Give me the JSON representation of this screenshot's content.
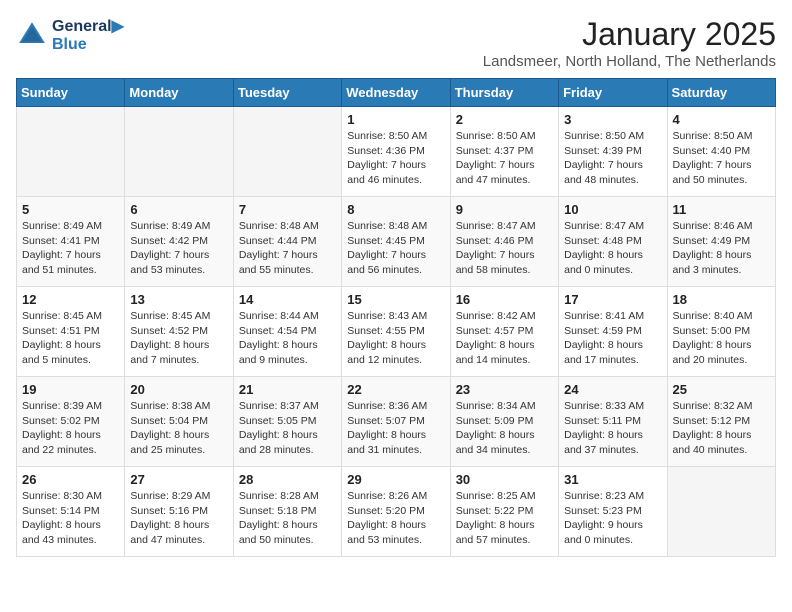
{
  "logo": {
    "line1": "General",
    "line2": "Blue"
  },
  "title": "January 2025",
  "subtitle": "Landsmeer, North Holland, The Netherlands",
  "weekdays": [
    "Sunday",
    "Monday",
    "Tuesday",
    "Wednesday",
    "Thursday",
    "Friday",
    "Saturday"
  ],
  "weeks": [
    [
      {
        "day": "",
        "info": ""
      },
      {
        "day": "",
        "info": ""
      },
      {
        "day": "",
        "info": ""
      },
      {
        "day": "1",
        "info": "Sunrise: 8:50 AM\nSunset: 4:36 PM\nDaylight: 7 hours and 46 minutes."
      },
      {
        "day": "2",
        "info": "Sunrise: 8:50 AM\nSunset: 4:37 PM\nDaylight: 7 hours and 47 minutes."
      },
      {
        "day": "3",
        "info": "Sunrise: 8:50 AM\nSunset: 4:39 PM\nDaylight: 7 hours and 48 minutes."
      },
      {
        "day": "4",
        "info": "Sunrise: 8:50 AM\nSunset: 4:40 PM\nDaylight: 7 hours and 50 minutes."
      }
    ],
    [
      {
        "day": "5",
        "info": "Sunrise: 8:49 AM\nSunset: 4:41 PM\nDaylight: 7 hours and 51 minutes."
      },
      {
        "day": "6",
        "info": "Sunrise: 8:49 AM\nSunset: 4:42 PM\nDaylight: 7 hours and 53 minutes."
      },
      {
        "day": "7",
        "info": "Sunrise: 8:48 AM\nSunset: 4:44 PM\nDaylight: 7 hours and 55 minutes."
      },
      {
        "day": "8",
        "info": "Sunrise: 8:48 AM\nSunset: 4:45 PM\nDaylight: 7 hours and 56 minutes."
      },
      {
        "day": "9",
        "info": "Sunrise: 8:47 AM\nSunset: 4:46 PM\nDaylight: 7 hours and 58 minutes."
      },
      {
        "day": "10",
        "info": "Sunrise: 8:47 AM\nSunset: 4:48 PM\nDaylight: 8 hours and 0 minutes."
      },
      {
        "day": "11",
        "info": "Sunrise: 8:46 AM\nSunset: 4:49 PM\nDaylight: 8 hours and 3 minutes."
      }
    ],
    [
      {
        "day": "12",
        "info": "Sunrise: 8:45 AM\nSunset: 4:51 PM\nDaylight: 8 hours and 5 minutes."
      },
      {
        "day": "13",
        "info": "Sunrise: 8:45 AM\nSunset: 4:52 PM\nDaylight: 8 hours and 7 minutes."
      },
      {
        "day": "14",
        "info": "Sunrise: 8:44 AM\nSunset: 4:54 PM\nDaylight: 8 hours and 9 minutes."
      },
      {
        "day": "15",
        "info": "Sunrise: 8:43 AM\nSunset: 4:55 PM\nDaylight: 8 hours and 12 minutes."
      },
      {
        "day": "16",
        "info": "Sunrise: 8:42 AM\nSunset: 4:57 PM\nDaylight: 8 hours and 14 minutes."
      },
      {
        "day": "17",
        "info": "Sunrise: 8:41 AM\nSunset: 4:59 PM\nDaylight: 8 hours and 17 minutes."
      },
      {
        "day": "18",
        "info": "Sunrise: 8:40 AM\nSunset: 5:00 PM\nDaylight: 8 hours and 20 minutes."
      }
    ],
    [
      {
        "day": "19",
        "info": "Sunrise: 8:39 AM\nSunset: 5:02 PM\nDaylight: 8 hours and 22 minutes."
      },
      {
        "day": "20",
        "info": "Sunrise: 8:38 AM\nSunset: 5:04 PM\nDaylight: 8 hours and 25 minutes."
      },
      {
        "day": "21",
        "info": "Sunrise: 8:37 AM\nSunset: 5:05 PM\nDaylight: 8 hours and 28 minutes."
      },
      {
        "day": "22",
        "info": "Sunrise: 8:36 AM\nSunset: 5:07 PM\nDaylight: 8 hours and 31 minutes."
      },
      {
        "day": "23",
        "info": "Sunrise: 8:34 AM\nSunset: 5:09 PM\nDaylight: 8 hours and 34 minutes."
      },
      {
        "day": "24",
        "info": "Sunrise: 8:33 AM\nSunset: 5:11 PM\nDaylight: 8 hours and 37 minutes."
      },
      {
        "day": "25",
        "info": "Sunrise: 8:32 AM\nSunset: 5:12 PM\nDaylight: 8 hours and 40 minutes."
      }
    ],
    [
      {
        "day": "26",
        "info": "Sunrise: 8:30 AM\nSunset: 5:14 PM\nDaylight: 8 hours and 43 minutes."
      },
      {
        "day": "27",
        "info": "Sunrise: 8:29 AM\nSunset: 5:16 PM\nDaylight: 8 hours and 47 minutes."
      },
      {
        "day": "28",
        "info": "Sunrise: 8:28 AM\nSunset: 5:18 PM\nDaylight: 8 hours and 50 minutes."
      },
      {
        "day": "29",
        "info": "Sunrise: 8:26 AM\nSunset: 5:20 PM\nDaylight: 8 hours and 53 minutes."
      },
      {
        "day": "30",
        "info": "Sunrise: 8:25 AM\nSunset: 5:22 PM\nDaylight: 8 hours and 57 minutes."
      },
      {
        "day": "31",
        "info": "Sunrise: 8:23 AM\nSunset: 5:23 PM\nDaylight: 9 hours and 0 minutes."
      },
      {
        "day": "",
        "info": ""
      }
    ]
  ]
}
